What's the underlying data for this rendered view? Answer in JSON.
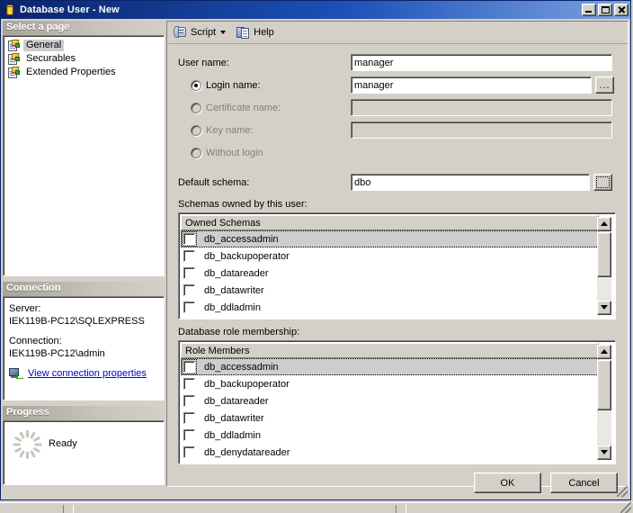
{
  "window": {
    "title": "Database User - New",
    "icon": "database-icon",
    "minimize_label": "Minimize",
    "maximize_label": "Maximize",
    "close_label": "Close"
  },
  "sidebar": {
    "header": "Select a page",
    "pages": [
      {
        "label": "General",
        "selected": true
      },
      {
        "label": "Securables",
        "selected": false
      },
      {
        "label": "Extended Properties",
        "selected": false
      }
    ],
    "connection": {
      "header": "Connection",
      "server_label": "Server:",
      "server_value": "IEK119B-PC12\\SQLEXPRESS",
      "connection_label": "Connection:",
      "connection_value": "IEK119B-PC12\\admin",
      "view_properties_link": "View connection properties"
    },
    "progress": {
      "header": "Progress",
      "status": "Ready"
    }
  },
  "toolbar": {
    "script_label": "Script",
    "help_label": "Help"
  },
  "form": {
    "user_name_label": "User name:",
    "user_name_value": "manager",
    "login_name_label": "Login name:",
    "login_name_value": "manager",
    "login_name_selected": true,
    "certificate_name_label": "Certificate name:",
    "certificate_name_value": "",
    "key_name_label": "Key name:",
    "key_name_value": "",
    "without_login_label": "Without login",
    "default_schema_label": "Default schema:",
    "default_schema_value": "dbo",
    "browse_button_label": "..."
  },
  "owned_schemas": {
    "section_label": "Schemas owned by this user:",
    "column_header": "Owned Schemas",
    "rows": [
      {
        "label": "db_accessadmin",
        "checked": false,
        "selected": true
      },
      {
        "label": "db_backupoperator",
        "checked": false,
        "selected": false
      },
      {
        "label": "db_datareader",
        "checked": false,
        "selected": false
      },
      {
        "label": "db_datawriter",
        "checked": false,
        "selected": false
      },
      {
        "label": "db_ddladmin",
        "checked": false,
        "selected": false
      }
    ]
  },
  "role_membership": {
    "section_label": "Database role membership:",
    "column_header": "Role Members",
    "rows": [
      {
        "label": "db_accessadmin",
        "checked": false,
        "selected": true
      },
      {
        "label": "db_backupoperator",
        "checked": false,
        "selected": false
      },
      {
        "label": "db_datareader",
        "checked": false,
        "selected": false
      },
      {
        "label": "db_datawriter",
        "checked": false,
        "selected": false
      },
      {
        "label": "db_ddladmin",
        "checked": false,
        "selected": false
      },
      {
        "label": "db_denydatareader",
        "checked": false,
        "selected": false
      }
    ]
  },
  "buttons": {
    "ok": "OK",
    "cancel": "Cancel"
  }
}
